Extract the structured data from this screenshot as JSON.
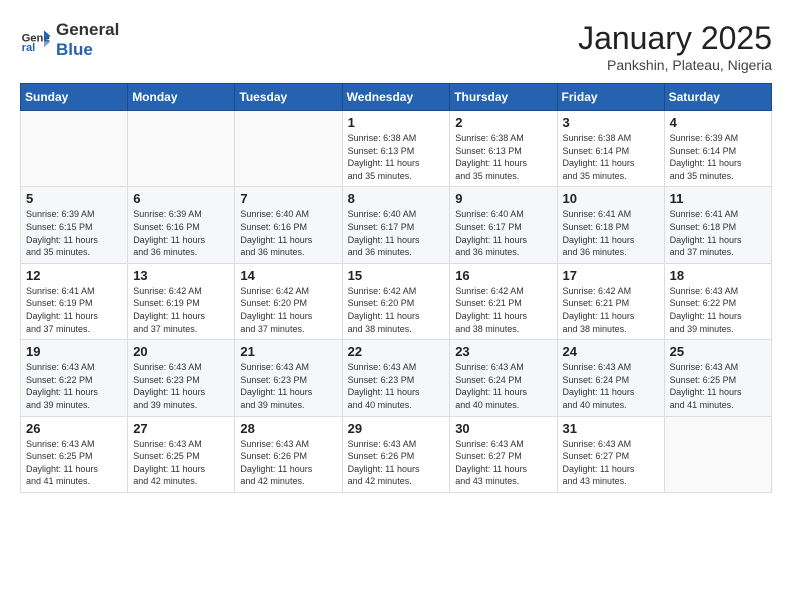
{
  "header": {
    "logo_line1": "General",
    "logo_line2": "Blue",
    "month_title": "January 2025",
    "location": "Pankshin, Plateau, Nigeria"
  },
  "days_of_week": [
    "Sunday",
    "Monday",
    "Tuesday",
    "Wednesday",
    "Thursday",
    "Friday",
    "Saturday"
  ],
  "weeks": [
    [
      {
        "day": "",
        "info": ""
      },
      {
        "day": "",
        "info": ""
      },
      {
        "day": "",
        "info": ""
      },
      {
        "day": "1",
        "info": "Sunrise: 6:38 AM\nSunset: 6:13 PM\nDaylight: 11 hours\nand 35 minutes."
      },
      {
        "day": "2",
        "info": "Sunrise: 6:38 AM\nSunset: 6:13 PM\nDaylight: 11 hours\nand 35 minutes."
      },
      {
        "day": "3",
        "info": "Sunrise: 6:38 AM\nSunset: 6:14 PM\nDaylight: 11 hours\nand 35 minutes."
      },
      {
        "day": "4",
        "info": "Sunrise: 6:39 AM\nSunset: 6:14 PM\nDaylight: 11 hours\nand 35 minutes."
      }
    ],
    [
      {
        "day": "5",
        "info": "Sunrise: 6:39 AM\nSunset: 6:15 PM\nDaylight: 11 hours\nand 35 minutes."
      },
      {
        "day": "6",
        "info": "Sunrise: 6:39 AM\nSunset: 6:16 PM\nDaylight: 11 hours\nand 36 minutes."
      },
      {
        "day": "7",
        "info": "Sunrise: 6:40 AM\nSunset: 6:16 PM\nDaylight: 11 hours\nand 36 minutes."
      },
      {
        "day": "8",
        "info": "Sunrise: 6:40 AM\nSunset: 6:17 PM\nDaylight: 11 hours\nand 36 minutes."
      },
      {
        "day": "9",
        "info": "Sunrise: 6:40 AM\nSunset: 6:17 PM\nDaylight: 11 hours\nand 36 minutes."
      },
      {
        "day": "10",
        "info": "Sunrise: 6:41 AM\nSunset: 6:18 PM\nDaylight: 11 hours\nand 36 minutes."
      },
      {
        "day": "11",
        "info": "Sunrise: 6:41 AM\nSunset: 6:18 PM\nDaylight: 11 hours\nand 37 minutes."
      }
    ],
    [
      {
        "day": "12",
        "info": "Sunrise: 6:41 AM\nSunset: 6:19 PM\nDaylight: 11 hours\nand 37 minutes."
      },
      {
        "day": "13",
        "info": "Sunrise: 6:42 AM\nSunset: 6:19 PM\nDaylight: 11 hours\nand 37 minutes."
      },
      {
        "day": "14",
        "info": "Sunrise: 6:42 AM\nSunset: 6:20 PM\nDaylight: 11 hours\nand 37 minutes."
      },
      {
        "day": "15",
        "info": "Sunrise: 6:42 AM\nSunset: 6:20 PM\nDaylight: 11 hours\nand 38 minutes."
      },
      {
        "day": "16",
        "info": "Sunrise: 6:42 AM\nSunset: 6:21 PM\nDaylight: 11 hours\nand 38 minutes."
      },
      {
        "day": "17",
        "info": "Sunrise: 6:42 AM\nSunset: 6:21 PM\nDaylight: 11 hours\nand 38 minutes."
      },
      {
        "day": "18",
        "info": "Sunrise: 6:43 AM\nSunset: 6:22 PM\nDaylight: 11 hours\nand 39 minutes."
      }
    ],
    [
      {
        "day": "19",
        "info": "Sunrise: 6:43 AM\nSunset: 6:22 PM\nDaylight: 11 hours\nand 39 minutes."
      },
      {
        "day": "20",
        "info": "Sunrise: 6:43 AM\nSunset: 6:23 PM\nDaylight: 11 hours\nand 39 minutes."
      },
      {
        "day": "21",
        "info": "Sunrise: 6:43 AM\nSunset: 6:23 PM\nDaylight: 11 hours\nand 39 minutes."
      },
      {
        "day": "22",
        "info": "Sunrise: 6:43 AM\nSunset: 6:23 PM\nDaylight: 11 hours\nand 40 minutes."
      },
      {
        "day": "23",
        "info": "Sunrise: 6:43 AM\nSunset: 6:24 PM\nDaylight: 11 hours\nand 40 minutes."
      },
      {
        "day": "24",
        "info": "Sunrise: 6:43 AM\nSunset: 6:24 PM\nDaylight: 11 hours\nand 40 minutes."
      },
      {
        "day": "25",
        "info": "Sunrise: 6:43 AM\nSunset: 6:25 PM\nDaylight: 11 hours\nand 41 minutes."
      }
    ],
    [
      {
        "day": "26",
        "info": "Sunrise: 6:43 AM\nSunset: 6:25 PM\nDaylight: 11 hours\nand 41 minutes."
      },
      {
        "day": "27",
        "info": "Sunrise: 6:43 AM\nSunset: 6:25 PM\nDaylight: 11 hours\nand 42 minutes."
      },
      {
        "day": "28",
        "info": "Sunrise: 6:43 AM\nSunset: 6:26 PM\nDaylight: 11 hours\nand 42 minutes."
      },
      {
        "day": "29",
        "info": "Sunrise: 6:43 AM\nSunset: 6:26 PM\nDaylight: 11 hours\nand 42 minutes."
      },
      {
        "day": "30",
        "info": "Sunrise: 6:43 AM\nSunset: 6:27 PM\nDaylight: 11 hours\nand 43 minutes."
      },
      {
        "day": "31",
        "info": "Sunrise: 6:43 AM\nSunset: 6:27 PM\nDaylight: 11 hours\nand 43 minutes."
      },
      {
        "day": "",
        "info": ""
      }
    ]
  ]
}
